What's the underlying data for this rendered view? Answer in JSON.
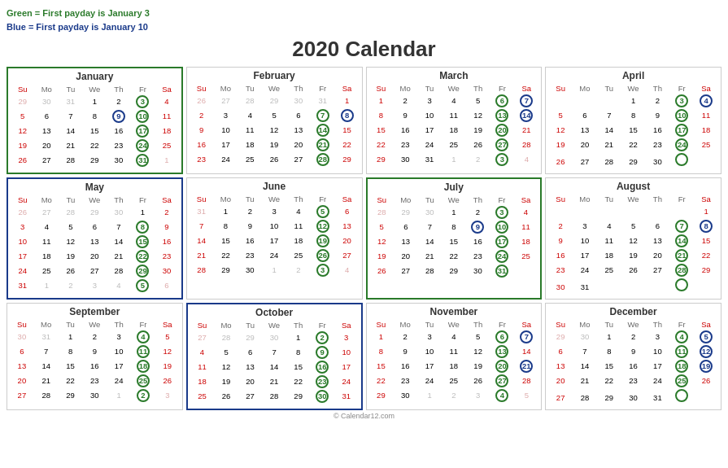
{
  "legend": {
    "green_label": "Green = First payday is January 3",
    "blue_label": "Blue = First payday is January 10"
  },
  "title": "2020 Calendar",
  "copyright": "© Calendar12.com",
  "months": [
    {
      "name": "January",
      "border": "green",
      "weeks": [
        [
          "29",
          "30",
          "31",
          "1",
          "2",
          "3",
          "4"
        ],
        [
          "5",
          "6",
          "7",
          "8",
          "9",
          "10",
          "11"
        ],
        [
          "12",
          "13",
          "14",
          "15",
          "16",
          "17",
          "18"
        ],
        [
          "19",
          "20",
          "21",
          "22",
          "23",
          "24",
          "25"
        ],
        [
          "26",
          "27",
          "28",
          "29",
          "30",
          "31",
          "1"
        ]
      ],
      "other_month_cells": [
        [
          0,
          0
        ],
        [
          0,
          1
        ],
        [
          0,
          2
        ],
        [
          4,
          6
        ]
      ],
      "green_circles": [
        [
          0,
          5
        ],
        [
          1,
          5
        ],
        [
          2,
          5
        ],
        [
          3,
          5
        ],
        [
          4,
          5
        ]
      ],
      "blue_circles": [
        [
          1,
          4
        ]
      ]
    },
    {
      "name": "February",
      "border": "none",
      "weeks": [
        [
          "26",
          "27",
          "28",
          "29",
          "30",
          "31",
          "1"
        ],
        [
          "2",
          "3",
          "4",
          "5",
          "6",
          "7",
          "8"
        ],
        [
          "9",
          "10",
          "11",
          "12",
          "13",
          "14",
          "15"
        ],
        [
          "16",
          "17",
          "18",
          "19",
          "20",
          "21",
          "22"
        ],
        [
          "23",
          "24",
          "25",
          "26",
          "27",
          "28",
          "29"
        ]
      ],
      "other_month_cells": [
        [
          0,
          0
        ],
        [
          0,
          1
        ],
        [
          0,
          2
        ],
        [
          0,
          3
        ],
        [
          0,
          4
        ],
        [
          0,
          5
        ]
      ],
      "green_circles": [
        [
          1,
          5
        ],
        [
          2,
          5
        ],
        [
          3,
          5
        ],
        [
          4,
          5
        ]
      ],
      "blue_circles": [
        [
          1,
          6
        ]
      ]
    },
    {
      "name": "March",
      "border": "none",
      "weeks": [
        [
          "1",
          "2",
          "3",
          "4",
          "5",
          "6",
          "7"
        ],
        [
          "8",
          "9",
          "10",
          "11",
          "12",
          "13",
          "14"
        ],
        [
          "15",
          "16",
          "17",
          "18",
          "19",
          "20",
          "21"
        ],
        [
          "22",
          "23",
          "24",
          "25",
          "26",
          "27",
          "28"
        ],
        [
          "29",
          "30",
          "31",
          "1",
          "2",
          "3",
          "4"
        ]
      ],
      "other_month_cells": [
        [
          4,
          3
        ],
        [
          4,
          4
        ],
        [
          4,
          5
        ],
        [
          4,
          6
        ]
      ],
      "green_circles": [
        [
          0,
          5
        ],
        [
          1,
          5
        ],
        [
          2,
          5
        ],
        [
          3,
          5
        ],
        [
          4,
          5
        ]
      ],
      "blue_circles": [
        [
          0,
          6
        ],
        [
          1,
          6
        ]
      ]
    },
    {
      "name": "April",
      "border": "none",
      "weeks": [
        [
          "",
          "",
          "",
          "1",
          "2",
          "3",
          "4"
        ],
        [
          "5",
          "6",
          "7",
          "8",
          "9",
          "10",
          "11"
        ],
        [
          "12",
          "13",
          "14",
          "15",
          "16",
          "17",
          "18"
        ],
        [
          "19",
          "20",
          "21",
          "22",
          "23",
          "24",
          "25"
        ],
        [
          "26",
          "27",
          "28",
          "29",
          "30",
          "",
          ""
        ]
      ],
      "other_month_cells": [
        [
          4,
          5
        ],
        [
          4,
          6
        ]
      ],
      "green_circles": [
        [
          0,
          5
        ],
        [
          1,
          5
        ],
        [
          2,
          5
        ],
        [
          3,
          5
        ],
        [
          4,
          5
        ]
      ],
      "blue_circles": [
        [
          0,
          6
        ],
        [
          1,
          5
        ]
      ]
    },
    {
      "name": "May",
      "border": "blue",
      "weeks": [
        [
          "26",
          "27",
          "28",
          "29",
          "30",
          "1",
          "2"
        ],
        [
          "3",
          "4",
          "5",
          "6",
          "7",
          "8",
          "9"
        ],
        [
          "10",
          "11",
          "12",
          "13",
          "14",
          "15",
          "16"
        ],
        [
          "17",
          "18",
          "19",
          "20",
          "21",
          "22",
          "23"
        ],
        [
          "24",
          "25",
          "26",
          "27",
          "28",
          "29",
          "30"
        ],
        [
          "31",
          "1",
          "2",
          "3",
          "4",
          "5",
          "6"
        ]
      ],
      "other_month_cells": [
        [
          0,
          0
        ],
        [
          0,
          1
        ],
        [
          0,
          2
        ],
        [
          0,
          3
        ],
        [
          0,
          4
        ],
        [
          5,
          1
        ],
        [
          5,
          2
        ],
        [
          5,
          3
        ],
        [
          5,
          4
        ],
        [
          5,
          5
        ],
        [
          5,
          6
        ]
      ],
      "green_circles": [
        [
          1,
          5
        ],
        [
          2,
          5
        ],
        [
          3,
          5
        ],
        [
          4,
          5
        ],
        [
          5,
          5
        ]
      ],
      "blue_circles": [
        [
          1,
          5
        ],
        [
          2,
          5
        ]
      ]
    },
    {
      "name": "June",
      "border": "none",
      "weeks": [
        [
          "31",
          "1",
          "2",
          "3",
          "4",
          "5",
          "6"
        ],
        [
          "7",
          "8",
          "9",
          "10",
          "11",
          "12",
          "13"
        ],
        [
          "14",
          "15",
          "16",
          "17",
          "18",
          "19",
          "20"
        ],
        [
          "21",
          "22",
          "23",
          "24",
          "25",
          "26",
          "27"
        ],
        [
          "28",
          "29",
          "30",
          "1",
          "2",
          "3",
          "4"
        ]
      ],
      "other_month_cells": [
        [
          0,
          0
        ],
        [
          4,
          3
        ],
        [
          4,
          4
        ],
        [
          4,
          5
        ],
        [
          4,
          6
        ]
      ],
      "green_circles": [
        [
          0,
          5
        ],
        [
          1,
          5
        ],
        [
          2,
          5
        ],
        [
          3,
          5
        ],
        [
          4,
          5
        ]
      ],
      "blue_circles": [
        [
          0,
          5
        ],
        [
          3,
          5
        ]
      ]
    },
    {
      "name": "July",
      "border": "green",
      "weeks": [
        [
          "28",
          "29",
          "30",
          "1",
          "2",
          "3",
          "4"
        ],
        [
          "5",
          "6",
          "7",
          "8",
          "9",
          "10",
          "11"
        ],
        [
          "12",
          "13",
          "14",
          "15",
          "16",
          "17",
          "18"
        ],
        [
          "19",
          "20",
          "21",
          "22",
          "23",
          "24",
          "25"
        ],
        [
          "26",
          "27",
          "28",
          "29",
          "30",
          "31",
          ""
        ]
      ],
      "other_month_cells": [
        [
          0,
          0
        ],
        [
          0,
          1
        ],
        [
          0,
          2
        ],
        [
          4,
          6
        ]
      ],
      "green_circles": [
        [
          0,
          5
        ],
        [
          1,
          5
        ],
        [
          2,
          5
        ],
        [
          3,
          5
        ],
        [
          4,
          5
        ]
      ],
      "blue_circles": [
        [
          1,
          4
        ],
        [
          3,
          5
        ]
      ]
    },
    {
      "name": "August",
      "border": "none",
      "weeks": [
        [
          "",
          "",
          "",
          "",
          "",
          "",
          "1"
        ],
        [
          "2",
          "3",
          "4",
          "5",
          "6",
          "7",
          "8"
        ],
        [
          "9",
          "10",
          "11",
          "12",
          "13",
          "14",
          "15"
        ],
        [
          "16",
          "17",
          "18",
          "19",
          "20",
          "21",
          "22"
        ],
        [
          "23",
          "24",
          "25",
          "26",
          "27",
          "28",
          "29"
        ],
        [
          "30",
          "31",
          "",
          "",
          "",
          "",
          ""
        ]
      ],
      "other_month_cells": [
        [
          5,
          2
        ],
        [
          5,
          3
        ],
        [
          5,
          4
        ],
        [
          5,
          5
        ],
        [
          5,
          6
        ]
      ],
      "green_circles": [
        [
          1,
          5
        ],
        [
          2,
          5
        ],
        [
          3,
          5
        ],
        [
          4,
          5
        ],
        [
          5,
          5
        ]
      ],
      "blue_circles": [
        [
          1,
          6
        ],
        [
          3,
          5
        ]
      ]
    },
    {
      "name": "September",
      "border": "none",
      "weeks": [
        [
          "30",
          "31",
          "1",
          "2",
          "3",
          "4",
          "5"
        ],
        [
          "6",
          "7",
          "8",
          "9",
          "10",
          "11",
          "12"
        ],
        [
          "13",
          "14",
          "15",
          "16",
          "17",
          "18",
          "19"
        ],
        [
          "20",
          "21",
          "22",
          "23",
          "24",
          "25",
          "26"
        ],
        [
          "27",
          "28",
          "29",
          "30",
          "1",
          "2",
          "3"
        ]
      ],
      "other_month_cells": [
        [
          0,
          0
        ],
        [
          0,
          1
        ],
        [
          4,
          4
        ],
        [
          4,
          5
        ],
        [
          4,
          6
        ]
      ],
      "green_circles": [
        [
          0,
          5
        ],
        [
          1,
          5
        ],
        [
          2,
          5
        ],
        [
          3,
          5
        ],
        [
          4,
          5
        ]
      ],
      "blue_circles": [
        [
          1,
          5
        ],
        [
          3,
          5
        ]
      ]
    },
    {
      "name": "October",
      "border": "blue",
      "weeks": [
        [
          "27",
          "28",
          "29",
          "30",
          "1",
          "2",
          "3"
        ],
        [
          "4",
          "5",
          "6",
          "7",
          "8",
          "9",
          "10"
        ],
        [
          "11",
          "12",
          "13",
          "14",
          "15",
          "16",
          "17"
        ],
        [
          "18",
          "19",
          "20",
          "21",
          "22",
          "23",
          "24"
        ],
        [
          "25",
          "26",
          "27",
          "28",
          "29",
          "30",
          "31"
        ]
      ],
      "other_month_cells": [
        [
          0,
          0
        ],
        [
          0,
          1
        ],
        [
          0,
          2
        ],
        [
          0,
          3
        ]
      ],
      "green_circles": [
        [
          0,
          5
        ],
        [
          1,
          5
        ],
        [
          2,
          5
        ],
        [
          3,
          5
        ],
        [
          4,
          5
        ]
      ],
      "blue_circles": [
        [
          1,
          5
        ],
        [
          2,
          5
        ],
        [
          3,
          5
        ],
        [
          4,
          5
        ]
      ]
    },
    {
      "name": "November",
      "border": "none",
      "weeks": [
        [
          "1",
          "2",
          "3",
          "4",
          "5",
          "6",
          "7"
        ],
        [
          "8",
          "9",
          "10",
          "11",
          "12",
          "13",
          "14"
        ],
        [
          "15",
          "16",
          "17",
          "18",
          "19",
          "20",
          "21"
        ],
        [
          "22",
          "23",
          "24",
          "25",
          "26",
          "27",
          "28"
        ],
        [
          "29",
          "30",
          "1",
          "2",
          "3",
          "4",
          "5"
        ]
      ],
      "other_month_cells": [
        [
          4,
          2
        ],
        [
          4,
          3
        ],
        [
          4,
          4
        ],
        [
          4,
          5
        ],
        [
          4,
          6
        ]
      ],
      "green_circles": [
        [
          0,
          5
        ],
        [
          1,
          5
        ],
        [
          2,
          5
        ],
        [
          3,
          5
        ],
        [
          4,
          5
        ]
      ],
      "blue_circles": [
        [
          0,
          6
        ],
        [
          1,
          5
        ],
        [
          2,
          6
        ]
      ]
    },
    {
      "name": "December",
      "border": "none",
      "weeks": [
        [
          "29",
          "30",
          "1",
          "2",
          "3",
          "4",
          "5"
        ],
        [
          "6",
          "7",
          "8",
          "9",
          "10",
          "11",
          "12"
        ],
        [
          "13",
          "14",
          "15",
          "16",
          "17",
          "18",
          "19"
        ],
        [
          "20",
          "21",
          "22",
          "23",
          "24",
          "25",
          "26"
        ],
        [
          "27",
          "28",
          "29",
          "30",
          "31",
          "",
          ""
        ]
      ],
      "other_month_cells": [
        [
          0,
          0
        ],
        [
          0,
          1
        ],
        [
          4,
          5
        ],
        [
          4,
          6
        ]
      ],
      "green_circles": [
        [
          0,
          5
        ],
        [
          1,
          5
        ],
        [
          2,
          5
        ],
        [
          3,
          5
        ],
        [
          4,
          5
        ]
      ],
      "blue_circles": [
        [
          0,
          6
        ],
        [
          1,
          6
        ],
        [
          2,
          6
        ],
        [
          3,
          5
        ]
      ]
    }
  ]
}
